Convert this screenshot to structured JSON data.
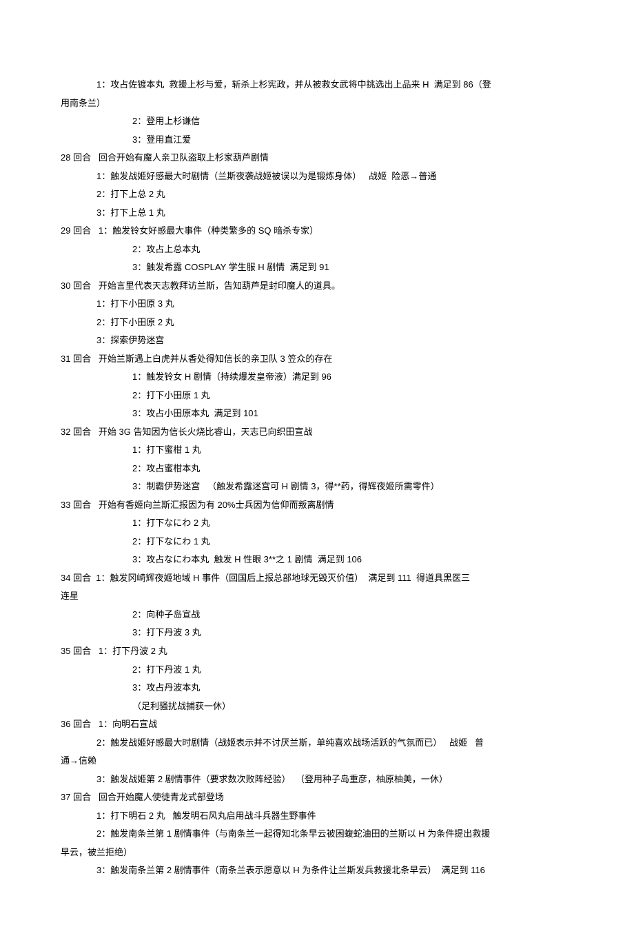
{
  "lines": [
    {
      "cls": "indent-2",
      "text": "1：攻占佐镀本丸  救援上杉与爱，斩杀上杉宪政，并从被救女武将中挑选出上品来 H  满足到 86（登"
    },
    {
      "cls": "indent-1",
      "text": "用南条兰）"
    },
    {
      "cls": "indent-3",
      "text": "2：登用上杉谦信"
    },
    {
      "cls": "indent-3",
      "text": "3：登用直江爱"
    },
    {
      "cls": "indent-1",
      "text": "28 回合   回合开始有魔人亲卫队盗取上杉家葫芦剧情"
    },
    {
      "cls": "indent-2",
      "text": "1：触发战姬好感最大时剧情（兰斯夜袭战姬被误以为是锻炼身体）   战姬  险恶→普通"
    },
    {
      "cls": "indent-2",
      "text": "2：打下上总 2 丸"
    },
    {
      "cls": "indent-2",
      "text": "3：打下上总 1 丸"
    },
    {
      "cls": "indent-1",
      "text": "29 回合   1：触发铃女好感最大事件（种类繁多的 SQ 暗杀专家）"
    },
    {
      "cls": "indent-3",
      "text": "2：攻占上总本丸"
    },
    {
      "cls": "indent-3",
      "text": "3：触发希露 COSPLAY 学生服 H 剧情  满足到 91"
    },
    {
      "cls": "indent-1",
      "text": "30 回合   开始言里代表天志教拜访兰斯，告知葫芦是封印魔人的道具。"
    },
    {
      "cls": "indent-2",
      "text": "1：打下小田原 3 丸"
    },
    {
      "cls": "indent-2",
      "text": "2：打下小田原 2 丸"
    },
    {
      "cls": "indent-2",
      "text": "3：探索伊势迷宫"
    },
    {
      "cls": "indent-1",
      "text": "31 回合   开始兰斯遇上白虎并从香处得知信长的亲卫队 3 笠众的存在"
    },
    {
      "cls": "indent-3",
      "text": "1：触发铃女 H 剧情（持续爆发皇帝液）满足到 96"
    },
    {
      "cls": "indent-3",
      "text": "2：打下小田原 1 丸"
    },
    {
      "cls": "indent-3",
      "text": "3：攻占小田原本丸  满足到 101"
    },
    {
      "cls": "indent-1",
      "text": "32 回合   开始 3G 告知因为信长火烧比睿山，天志已向织田宣战"
    },
    {
      "cls": "indent-3",
      "text": "1：打下蜜柑 1 丸"
    },
    {
      "cls": "indent-3",
      "text": "2：攻占蜜柑本丸"
    },
    {
      "cls": "indent-3",
      "text": "3：制霸伊势迷宫   （触发希露迷宫可 H 剧情 3，得**药，得辉夜姬所需零件）"
    },
    {
      "cls": "indent-1",
      "text": "33 回合   开始有香姬向兰斯汇报因为有 20%士兵因为信仰而叛离剧情"
    },
    {
      "cls": "indent-3",
      "text": "1：打下なにわ 2 丸"
    },
    {
      "cls": "indent-3",
      "text": "2：打下なにわ 1 丸"
    },
    {
      "cls": "indent-3",
      "text": "3：攻占なにわ本丸  触发 H 性眼 3**之 1 剧情  满足到 106"
    },
    {
      "cls": "indent-1",
      "text": "34 回合  1：触发冈崎辉夜姬地域 H 事件（回国后上报总部地球无毁灭价值）  满足到 111  得道具黑医三"
    },
    {
      "cls": "indent-1",
      "text": "连星"
    },
    {
      "cls": "indent-3",
      "text": "2：向种子岛宣战"
    },
    {
      "cls": "indent-3",
      "text": "3：打下丹波 3 丸"
    },
    {
      "cls": "indent-1",
      "text": "35 回合   1：打下丹波 2 丸"
    },
    {
      "cls": "indent-3",
      "text": "2：打下丹波 1 丸"
    },
    {
      "cls": "indent-3",
      "text": "3：攻占丹波本丸"
    },
    {
      "cls": "indent-3",
      "text": "（足利骚扰战捕获一休）"
    },
    {
      "cls": "indent-1",
      "text": "36 回合   1：向明石宣战"
    },
    {
      "cls": "indent-2",
      "text": "2：触发战姬好感最大时剧情（战姬表示并不讨厌兰斯，单纯喜欢战场活跃的气氛而已）   战姬   普"
    },
    {
      "cls": "indent-1",
      "text": "通→信赖"
    },
    {
      "cls": "indent-2",
      "text": "3：触发战姬第 2 剧情事件（要求数次败阵经验）  （登用种子岛重彦，柚原柚美，一休）"
    },
    {
      "cls": "indent-1",
      "text": "37 回合   回合开始魔人使徒青龙式部登场"
    },
    {
      "cls": "indent-2",
      "text": "1：打下明石 2 丸   触发明石风丸启用战斗兵器生野事件"
    },
    {
      "cls": "indent-2",
      "text": "2：触发南条兰第 1 剧情事件（与南条兰一起得知北条早云被困蝮蛇油田的兰斯以 H 为条件提出救援"
    },
    {
      "cls": "indent-1",
      "text": "早云，被兰拒绝）"
    },
    {
      "cls": "indent-2",
      "text": "3：触发南条兰第 2 剧情事件（南条兰表示愿意以 H 为条件让兰斯发兵救援北条早云）  满足到 116"
    }
  ]
}
